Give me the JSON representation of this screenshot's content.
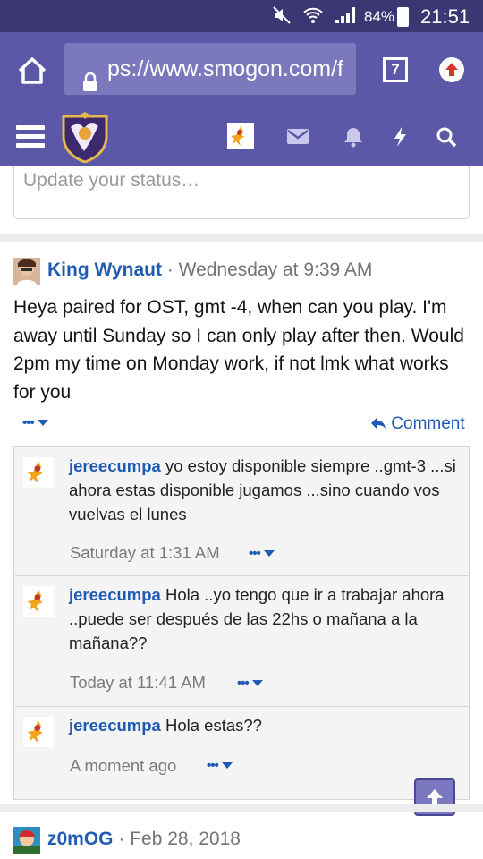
{
  "statusbar": {
    "battery": "84%",
    "time": "21:51"
  },
  "browser": {
    "url": "ps://www.smogon.com/f",
    "tab_count": "7"
  },
  "status_update": {
    "placeholder": "Update your status…"
  },
  "post": {
    "author": "King Wynaut",
    "time": "Wednesday at 9:39 AM",
    "body": "Heya paired for OST, gmt -4, when can you play. I'm away until Sunday so I can only play after then. Would 2pm my time on Monday work, if not lmk what works for you",
    "comment_label": "Comment",
    "more_label": "•••"
  },
  "comments": [
    {
      "author": "jereecumpa",
      "text": "yo estoy disponible siempre ..gmt-3 ...si ahora estas disponible jugamos ...sino cuando vos vuelvas el lunes",
      "time": "Saturday at 1:31 AM"
    },
    {
      "author": "jereecumpa",
      "text": "Hola ..yo tengo que ir a trabajar ahora ..puede ser después de las 22hs o mañana a la mañana??",
      "time": "Today at 11:41 AM"
    },
    {
      "author": "jereecumpa",
      "text": "Hola estas??",
      "time": "A moment ago"
    }
  ],
  "post2": {
    "author": "z0mOG",
    "time": "Feb 28, 2018"
  },
  "separator": " · "
}
